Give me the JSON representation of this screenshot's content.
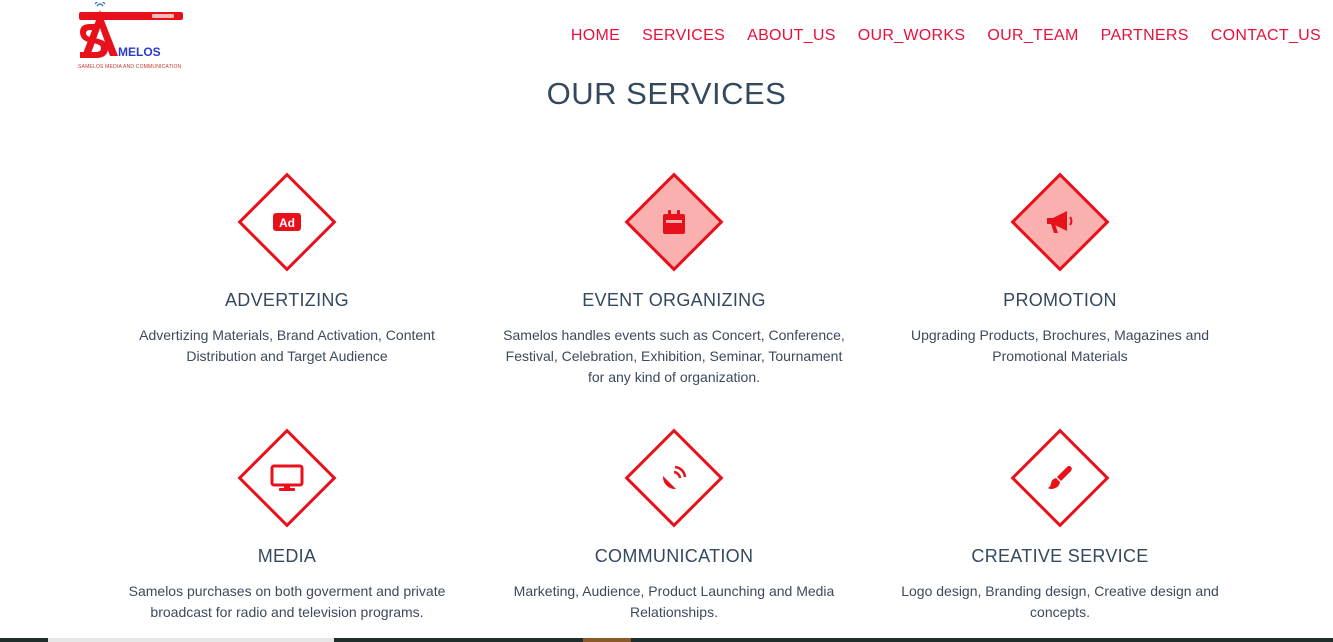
{
  "logo": {
    "text": "MELOS",
    "tagline": "SAMELOS MEDIA AND COMMUNICATION"
  },
  "nav": [
    "HOME",
    "SERVICES",
    "ABOUT_US",
    "OUR_WORKS",
    "OUR_TEAM",
    "PARTNERS",
    "CONTACT_US"
  ],
  "section_title": "OUR SERVICES",
  "services": [
    {
      "title": "ADVERTIZING",
      "description": "Advertizing Materials, Brand Activation, Content Distribution and Target Audience",
      "icon": "ad-icon",
      "filled": false
    },
    {
      "title": "EVENT ORGANIZING",
      "description": "Samelos handles events such as Concert, Conference, Festival, Celebration, Exhibition, Seminar, Tournament for any kind of organization.",
      "icon": "calendar-icon",
      "filled": true
    },
    {
      "title": "PROMOTION",
      "description": "Upgrading Products, Brochures, Magazines and Promotional Materials",
      "icon": "megaphone-icon",
      "filled": true
    },
    {
      "title": "MEDIA",
      "description": "Samelos purchases on both goverment and private broadcast for radio and television programs.",
      "icon": "monitor-icon",
      "filled": false
    },
    {
      "title": "COMMUNICATION",
      "description": "Marketing, Audience, Product Launching and Media Relationships.",
      "icon": "satellite-dish-icon",
      "filled": false
    },
    {
      "title": "CREATIVE SERVICE",
      "description": "Logo design, Branding design, Creative design and concepts.",
      "icon": "paint-brush-icon",
      "filled": false
    }
  ],
  "colors": {
    "accent": "#e8103a",
    "diamond_border": "#e8101a",
    "diamond_fill": "#fbb0b0",
    "heading": "#34495e"
  }
}
